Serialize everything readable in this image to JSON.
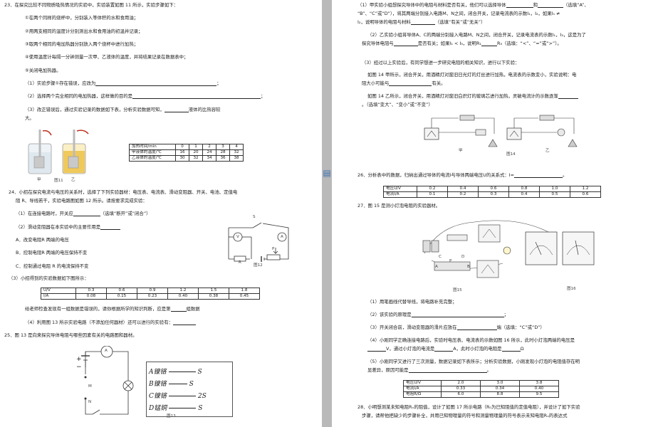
{
  "left": {
    "q23": {
      "l1": "23．在探究比较不同物质吸热情况的实验中，实验装置如图 11 所示，实验步骤如下：",
      "l2": "①在两个同样的烧杯中，分别装入等体积的水和食用油；",
      "l3": "②用两支相同的温度计分别测出水和食用油的初温并记录；",
      "l4": "③取两个相同的电加热器分别放入两个烧杯中进行加热；",
      "l5": "④使用温度计每隔一分钟测量一次甲、乙液体的温度，并将结果记录在数据表中；",
      "l6": "⑤关闭电加热器。",
      "l7": "（1）实验步骤①存在错误，应改为",
      "l8": "（2）选择两个完全相同的电加热器，这样做的目的是",
      "l9": "（3）改正错误后，通过实验记录的数据如下表，分析实验数据可知，",
      "l9b": "液体的比热容较",
      "l10": "大。",
      "fig_caption": "图11",
      "label_jia": "甲",
      "label_yi": "乙",
      "table": [
        [
          "加热时间/min",
          "0",
          "1",
          "2",
          "3",
          "4"
        ],
        [
          "甲液体的温度/℃",
          "16",
          "20",
          "24",
          "28",
          "32"
        ],
        [
          "乙液体的温度/℃",
          "30",
          "32",
          "34",
          "36",
          "38"
        ]
      ]
    },
    "q24": {
      "l1": "24．小招在探究电流与电压的关系时，选择了下列实验器材：电压表、电流表、滑动变阻器、开关、电池、定值电",
      "l2": "阻 R、导线若干，实验电路图如图 12 所示。请按要求完成实验：",
      "l3": "（1）在连接电路时，开关应",
      "l3b": "（选填“断开”或“闭合”）",
      "l4": "（2）滑动变阻器在本实验中的主要作用是",
      "opt_a": "A．改变电阻R 两端的电压",
      "opt_b": "B．控制电阻R 两端的电压保持不变",
      "opt_c": "C．控制通过电阻 R 的电流保持不变",
      "l5": "（3）小招得到的实验数据如下图所示：",
      "table": [
        [
          "U/V",
          "0.3",
          "0.6",
          "0.9",
          "1.2",
          "1.5",
          "1.8"
        ],
        [
          "I/A",
          "0.08",
          "0.15",
          "0.23",
          "0.40",
          "0.38",
          "0.45"
        ]
      ],
      "l6": "给老师检查发现有一组数据是错误的，请你根据所学的知识判断，应是第",
      "l6b": "组数据",
      "l7": "（4）利用图 13 所示实验电路（不添加任何器材）还可以进行的实验有：",
      "fig_caption": "图12",
      "label_s": "S",
      "label_r": "R",
      "label_p": "P",
      "meter_v": "V",
      "meter_a": "A"
    },
    "q25": {
      "l1": "25．图 13 是向来探究导体电阻与哪些因素有关的电路图和器材。",
      "fig_caption": "图13",
      "label_m": "M",
      "label_n": "N",
      "meter_a": "A",
      "wires": [
        {
          "key": "A",
          "name": "镍铬",
          "tail": "S"
        },
        {
          "key": "B",
          "name": "镍铬",
          "tail": "S"
        },
        {
          "key": "C",
          "name": "镍铬",
          "tail": "2S"
        },
        {
          "key": "D",
          "name": "锰铜",
          "tail": "S"
        }
      ]
    }
  },
  "right": {
    "q25c": {
      "l1a": "（1）甲实验小组想探究导体中的电阻与材料是否有关，他们可以选择导体",
      "l1b": "和",
      "l1c": "（选填“A”、",
      "l2": "“B”、“C”或“D”），将其两端分别接入电路M、N之间，闭合开关，记录电流表的示数I₁，I₂，如果I₁ ≠",
      "l3": "I₂，说明导体的电阻与材料",
      "l3b": "（选填“有关”或“无关”）",
      "l4": "（2）乙实验小组将导体A、C的两端分别接入电路M、N之间，闭合开关，记录电流表的示数I₁，I₃，这是为了",
      "l5": "探究导体电阻与",
      "l5b": "是否有关；如果I₁ < I₃，说明R₁",
      "l5c": "R₃（选填：“<”、“=”或“>”）。",
      "l6": "（3）经过以上实验后，有同学想进一步研究电阻的相关知识，进行以下实验：",
      "l7": "如图 14 甲所示，闭合开关，用酒精灯对废旧日光灯的灯丝进行加热，电流表的示数变小，实验说明：电",
      "l8": "阻大小可能与",
      "l8b": "有关。",
      "l9": "如图 14 乙所示，闭合开关，用酒精灯对废旧白炽灯的玻璃芯进行加热，灵敏电流计的示数逐渐",
      "l10": "。（选填“变大”、“变小”或“不变”）",
      "fig_caption": "图14",
      "label_jia": "甲",
      "label_yi": "乙"
    },
    "q26": {
      "l1": "26．分析表中的数据，归纳出通过导体的电流I与导体两端电压U的关系式：I=",
      "table": [
        [
          "电压U/V",
          "0.2",
          "0.4",
          "0.6",
          "0.8",
          "1.0",
          "1.2"
        ],
        [
          "电流I/A",
          "0.1",
          "0.2",
          "0.3",
          "0.4",
          "0.5",
          "0.6"
        ]
      ]
    },
    "q27": {
      "l1": "27．图 15 是测小灯泡电阻的实验器材。",
      "fig15_caption": "图15",
      "fig16_caption": "图16",
      "label_c": "C",
      "label_d": "D",
      "label_a": "A",
      "label_b": "B",
      "label_p": "P",
      "l2": "（1）用笔画线代替导线，将电路补充完整；",
      "l3": "（2）该实验的原理是",
      "l4": "（3）开关闭合前，滑动变阻器的滑片应放在",
      "l4b": "端（选填：“C”或“D”）",
      "l5": "（4）小刚同学正确连接电路后，实验时电压表、电流表的示数如图 16 所示，此时小灯泡两端的电压是",
      "l6": "V，通过小灯泡的电流是",
      "l6b": "A，此时小灯泡的电阻是",
      "l6c": "Ω",
      "l7": "（5）小刚同学又进行了三次测量，数据记录如下表所示；分析实验数据，小刚发现小灯泡的电阻值存在明",
      "l8": "显差异，原因可能是",
      "table": [
        [
          "电压U/V",
          "2.0",
          "3.0",
          "3.8"
        ],
        [
          "电流I/A",
          "0.33",
          "0.34",
          "0.40"
        ],
        [
          "电阻R/Ω",
          "6.0",
          "8.8",
          "9.5"
        ]
      ]
    },
    "q28": {
      "l1": "28．小明想测某未知电阻Rₓ的阻值，设计了如图 17 所示电路（R₀为已知阻值的定值电阻），并设计了如下实验",
      "l2": "步骤，请帮他把缺少的步骤补全，并用已知物理量的符号和测量物理量的符号表示未知电阻Rₓ的表达式"
    }
  },
  "ui": {
    "doc_icon": "document-icon"
  }
}
